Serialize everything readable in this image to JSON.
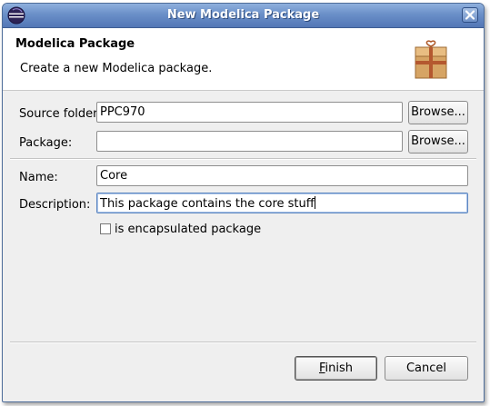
{
  "window": {
    "title": "New Modelica Package",
    "close_icon": "close-icon",
    "logo_icon": "eclipse-logo-icon"
  },
  "header": {
    "title": "Modelica Package",
    "description": "Create a new Modelica package.",
    "icon": "package-box-icon"
  },
  "form": {
    "source_folder": {
      "label": "Source folder:",
      "value": "PPC970",
      "browse_label": "Browse..."
    },
    "package": {
      "label": "Package:",
      "value": "",
      "browse_label": "Browse..."
    },
    "name": {
      "label": "Name:",
      "value": "Core"
    },
    "description": {
      "label": "Description:",
      "value": "This package contains the core stuff"
    },
    "encapsulated": {
      "label": "is encapsulated package",
      "checked": false
    }
  },
  "footer": {
    "finish_mnemonic": "F",
    "finish_rest": "inish",
    "cancel_label": "Cancel"
  }
}
